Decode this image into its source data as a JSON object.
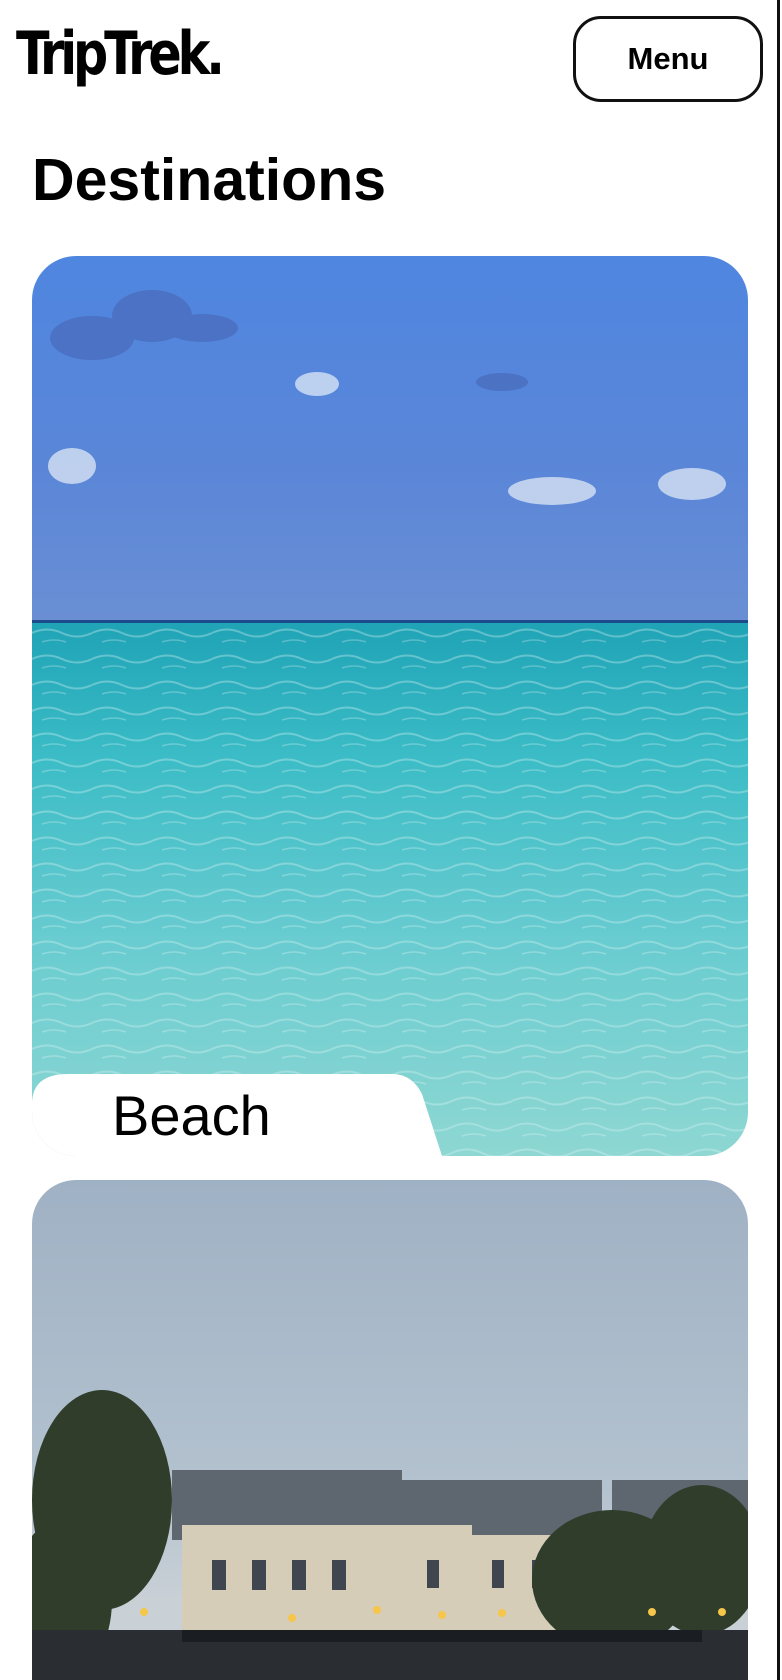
{
  "header": {
    "logo_text": "TripTrek.",
    "menu_label": "Menu"
  },
  "main": {
    "title": "Destinations",
    "destinations": [
      {
        "label": "Beach",
        "image": "turquoise-sea-under-blue-sky"
      },
      {
        "label": "",
        "image": "paris-riverside-buildings-at-dusk"
      }
    ]
  },
  "colors": {
    "accent": "#111111",
    "sky_blue": "#4f7fd6",
    "sea_turquoise": "#3fbcc4",
    "dusk_sky": "#a9b8c7"
  }
}
